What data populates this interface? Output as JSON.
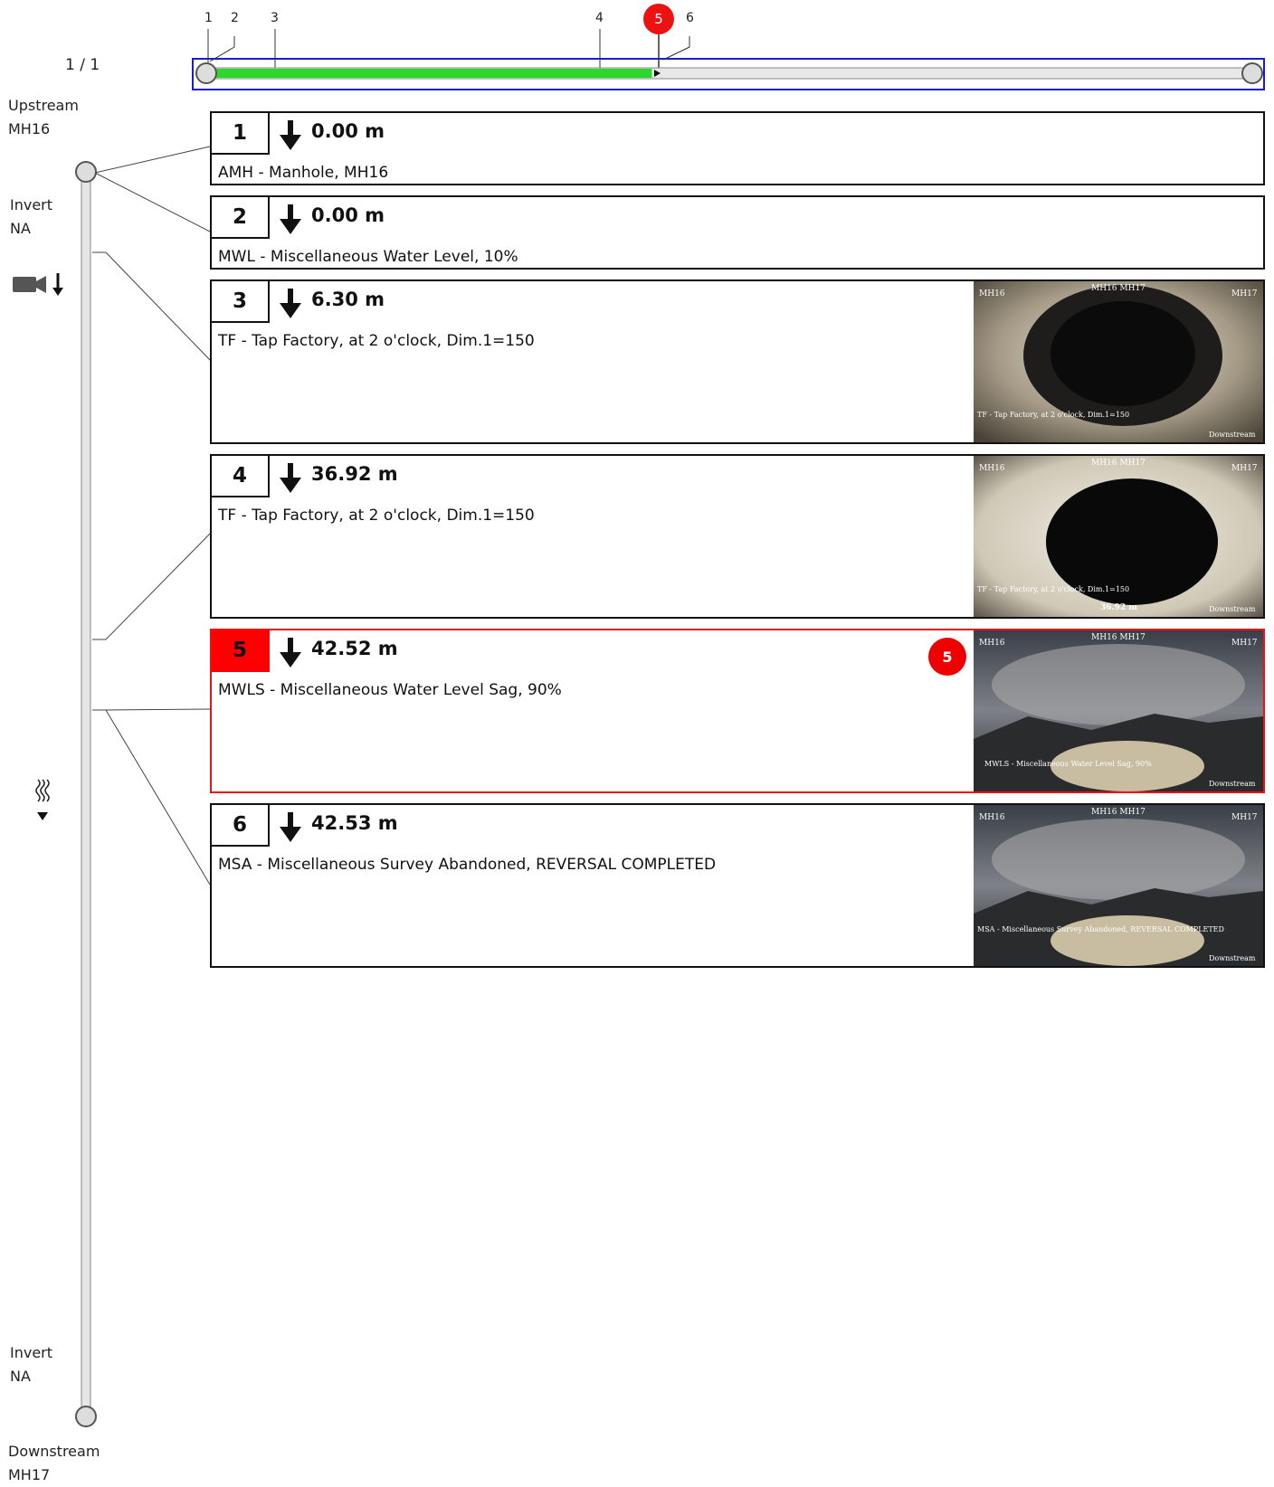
{
  "page_indicator": "1 / 1",
  "upstream": {
    "label": "Upstream",
    "manhole": "MH16"
  },
  "downstream": {
    "label": "Downstream",
    "manhole": "MH17"
  },
  "invert_top": {
    "label": "Invert",
    "value": "NA"
  },
  "invert_bottom": {
    "label": "Invert",
    "value": "NA"
  },
  "icons": {
    "camera": "camera-down-icon",
    "flow": "flow-direction-icon"
  },
  "colors": {
    "progress": "#2bd82b",
    "selected": "#ff0000",
    "frame": "#1b1bd6"
  },
  "progress": {
    "distance_m": 42.52,
    "total_m": 100.0
  },
  "timeline_ticks": [
    "1",
    "2",
    "3",
    "4",
    "5",
    "6"
  ],
  "observations": [
    {
      "num": "1",
      "distance": "0.00 m",
      "description": "AMH - Manhole, MH16",
      "has_photo": false,
      "selected": false
    },
    {
      "num": "2",
      "distance": "0.00 m",
      "description": "MWL - Miscellaneous Water Level, 10%",
      "has_photo": false,
      "selected": false
    },
    {
      "num": "3",
      "distance": "6.30 m",
      "description": "TF - Tap Factory, at 2 o'clock, Dim.1=150",
      "has_photo": true,
      "selected": false,
      "photo": {
        "left": "MH16",
        "center": "MH16 MH17",
        "right": "MH17",
        "caption": "TF - Tap Factory, at 2 o'clock, Dim.1=150",
        "bottom_right": "Downstream"
      }
    },
    {
      "num": "4",
      "distance": "36.92 m",
      "description": "TF - Tap Factory, at 2 o'clock, Dim.1=150",
      "has_photo": true,
      "selected": false,
      "photo": {
        "left": "MH16",
        "center": "MH16 MH17",
        "right": "MH17",
        "caption": "TF - Tap Factory, at 2 o'clock, Dim.1=150",
        "bottom_center": "36.92 m",
        "bottom_right": "Downstream"
      }
    },
    {
      "num": "5",
      "distance": "42.52 m",
      "description": "MWLS - Miscellaneous Water Level Sag, 90%",
      "has_photo": true,
      "selected": true,
      "marker": "5",
      "photo": {
        "left": "MH16",
        "center": "MH16 MH17",
        "right": "MH17",
        "caption": "MWLS - Miscellaneous Water Level Sag, 90%",
        "bottom_right": "Downstream"
      }
    },
    {
      "num": "6",
      "distance": "42.53 m",
      "description": "MSA - Miscellaneous Survey Abandoned, REVERSAL COMPLETED",
      "has_photo": true,
      "selected": false,
      "photo": {
        "left": "MH16",
        "center": "MH16 MH17",
        "right": "MH17",
        "caption": "MSA - Miscellaneous Survey Abandoned, REVERSAL COMPLETED",
        "bottom_right": "Downstream"
      }
    }
  ]
}
